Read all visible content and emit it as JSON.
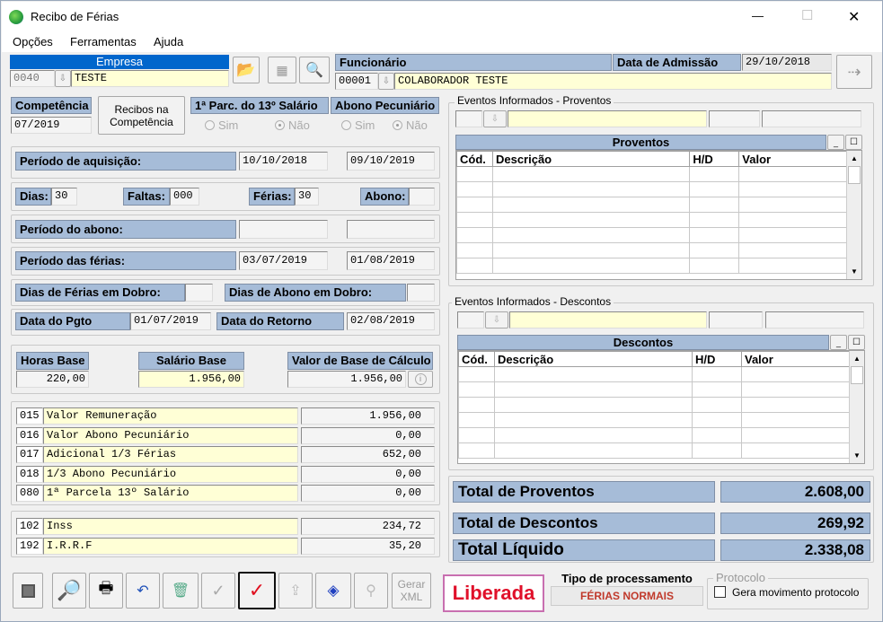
{
  "window": {
    "title": "Recibo de Férias",
    "min": "—",
    "max": "☐",
    "close": "✕"
  },
  "menu": [
    "Opções",
    "Ferramentas",
    "Ajuda"
  ],
  "empresa": {
    "label": "Empresa",
    "code": "0040",
    "name": "TESTE"
  },
  "funcionario": {
    "label": "Funcionário",
    "code": "00001",
    "name": "COLABORADOR TESTE",
    "adm_label": "Data de Admissão",
    "adm_date": "29/10/2018"
  },
  "competencia": {
    "label": "Competência",
    "value": "07/2019",
    "recibos_btn": "Recibos na Competência"
  },
  "parc13": {
    "label": "1ª Parc. do 13º Salário",
    "sim": "Sim",
    "nao": "Não"
  },
  "abono_pec": {
    "label": "Abono Pecuniário",
    "sim": "Sim",
    "nao": "Não"
  },
  "periodo_aquisicao": {
    "label": "Período de aquisição:",
    "start": "10/10/2018",
    "end": "09/10/2019"
  },
  "dias": {
    "dias_label": "Dias:",
    "dias": "30",
    "faltas_label": "Faltas:",
    "faltas": "000",
    "ferias_label": "Férias:",
    "ferias": "30",
    "abono_label": "Abono:",
    "abono": ""
  },
  "periodo_abono": {
    "label": "Período do abono:",
    "start": "",
    "end": ""
  },
  "periodo_ferias": {
    "label": "Período das férias:",
    "start": "03/07/2019",
    "end": "01/08/2019"
  },
  "dobro": {
    "ferias_label": "Dias de Férias em Dobro:",
    "ferias": "",
    "abono_label": "Dias de Abono em Dobro:",
    "abono": ""
  },
  "pgto": {
    "label": "Data do Pgto",
    "value": "01/07/2019",
    "retorno_label": "Data do Retorno",
    "retorno": "02/08/2019"
  },
  "base": {
    "horas_label": "Horas Base",
    "horas": "220,00",
    "salario_label": "Salário Base",
    "salario": "1.956,00",
    "calc_label": "Valor de Base de Cálculo",
    "calc": "1.956,00"
  },
  "proventos_list": [
    {
      "code": "015",
      "desc": "Valor Remuneração",
      "value": "1.956,00"
    },
    {
      "code": "016",
      "desc": "Valor Abono Pecuniário",
      "value": "0,00"
    },
    {
      "code": "017",
      "desc": "Adicional 1/3 Férias",
      "value": "652,00"
    },
    {
      "code": "018",
      "desc": "1/3 Abono Pecuniário",
      "value": "0,00"
    },
    {
      "code": "080",
      "desc": "1ª Parcela 13º Salário",
      "value": "0,00"
    }
  ],
  "descontos_list": [
    {
      "code": "102",
      "desc": "Inss",
      "value": "234,72"
    },
    {
      "code": "192",
      "desc": "I.R.R.F",
      "value": "35,20"
    }
  ],
  "eventos_prov": {
    "group": "Eventos Informados - Proventos",
    "title": "Proventos",
    "cols": [
      "Cód.",
      "Descrição",
      "H/D",
      "Valor"
    ]
  },
  "eventos_desc": {
    "group": "Eventos Informados - Descontos",
    "title": "Descontos",
    "cols": [
      "Cód.",
      "Descrição",
      "H/D",
      "Valor"
    ]
  },
  "totals": {
    "prov_label": "Total de Proventos",
    "prov": "2.608,00",
    "desc_label": "Total de Descontos",
    "desc": "269,92",
    "liq_label": "Total Líquido",
    "liq": "2.338,08"
  },
  "footer": {
    "gerar_xml": "Gerar XML",
    "status": "Liberada",
    "tipo_label": "Tipo de processamento",
    "tipo": "FÉRIAS NORMAIS",
    "protocolo_label": "Protocolo",
    "protocolo_check": "Gera movimento protocolo"
  },
  "colors": {
    "label_bg": "#a6bcd8",
    "yellow": "#ffffd6",
    "empresa_bar": "#0066cc",
    "status_red": "#e0102a",
    "tipo_red": "#c0392b"
  }
}
